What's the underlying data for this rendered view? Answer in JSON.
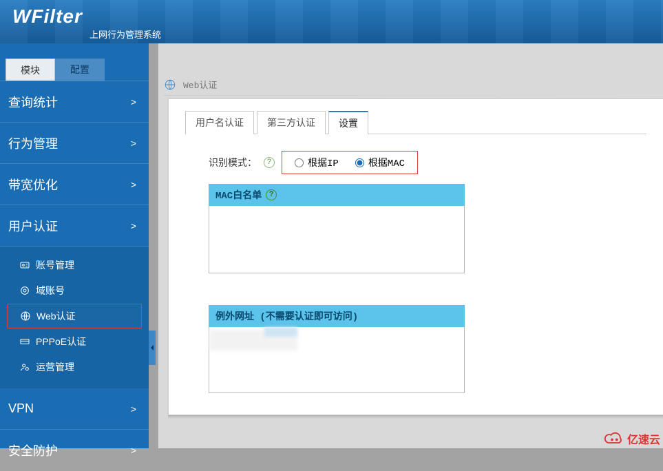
{
  "header": {
    "logo": "WFilter",
    "subtitle": "上网行为管理系统"
  },
  "side_tabs": {
    "modules": "模块",
    "config": "配置"
  },
  "menu": {
    "query": "查询统计",
    "behavior": "行为管理",
    "bandwidth": "带宽优化",
    "userauth": "用户认证",
    "vpn": "VPN",
    "security": "安全防护"
  },
  "submenu": {
    "account": "账号管理",
    "domain": "域账号",
    "webauth": "Web认证",
    "pppoe": "PPPoE认证",
    "operate": "运营管理"
  },
  "breadcrumb": {
    "title": "Web认证"
  },
  "tabs": {
    "user": "用户名认证",
    "third": "第三方认证",
    "settings": "设置"
  },
  "form": {
    "mode_label": "识别模式：",
    "by_ip": "根据IP",
    "by_mac": "根据MAC",
    "mac_whitelist": "MAC白名单",
    "exception_url": "例外网址 (不需要认证即可访问)"
  },
  "brand": "亿速云",
  "chevron": ">",
  "help": "?"
}
